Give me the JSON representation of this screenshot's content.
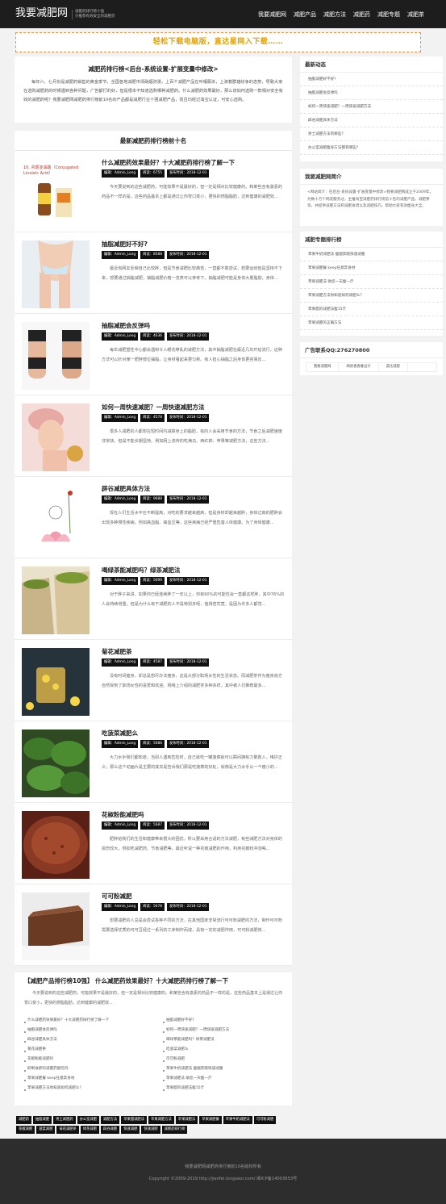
{
  "header": {
    "logo": "我要减肥网",
    "slogan_line1": "减肥药排行榜十强",
    "slogan_line2": "只推荐有效安全的减肥药",
    "nav": [
      "我要减肥网",
      "减肥产品",
      "减肥方法",
      "减肥药",
      "减肥专题",
      "减肥茶"
    ]
  },
  "banner": {
    "text": "轻松下载电脑版，直达星网入下载……"
  },
  "intro": {
    "title": "减肥药排行榜<后台-系统设置-扩展变量中修改>",
    "text": "每年六、七月份是减肥药销售的黄金季节，全国各地减肥市场硝烟弥漫，上百个减肥产品在叫嚷厮杀，上演着群雄纷争的态势，导致大家在选购减肥药的时候遇到各种问题，广告都打的好，但是根本不知道选购哪种减肥药。什么减肥药效果最好，那么该如何选购一款相对安全有效的减肥药呢？我要减肥网减肥药排行榜前10名的产品都是减肥行业十强减肥产品，而且均经过淘宝认证，可安心选购。"
  },
  "list_title": "最新减肥药排行榜前十名",
  "items": [
    {
      "title": "什么减肥药效果最好？十大减肥药排行榜了解一下",
      "author": "编辑：Admin_Long",
      "views": "阅读：6755",
      "date": "发布时间：2018-12-01",
      "desc": "今天要说到的这些减肥药，可能效果不是最好的，但一定是相对比较健康的。和某些含有激素的药品不一样的是，这些药品基本上都是通过让你胃口变小，更快的燃脂脂肪，达到健康的减肥效..."
    },
    {
      "title": "抽脂减肥好不好?",
      "author": "编辑：Admin_Long",
      "views": "阅读：8588",
      "date": "发布时间：2018-12-01",
      "desc": "最近有网友反映自己比较胖，但是节食减肥比较痛苦，一直都不敢尝试，想要运动但是坚持不下来，想要通过抽脂减肥，抽脂减肥价格一览表可以参考下。抽脂减肥可能是身体大量脂肪，身体..."
    },
    {
      "title": "抽脂减肥会反弹吗",
      "author": "编辑：Admin_Long",
      "views": "阅读：4636",
      "date": "发布时间：2018-12-01",
      "desc": "每年减肥塑性中心都会遇到令人眼花缭乱的减肥方法，其中抽脂减肥在最近几年开始流行，这种方法可以针对某一肥胖部位抽脂，让身材看起来更匀称。有人担心抽脂之后身体更容易反..."
    },
    {
      "title": "如何一周快速减肥？一周快速减肥方法",
      "author": "编辑：Admin_Long",
      "views": "阅读：4578",
      "date": "发布时间：2018-12-01",
      "desc": "很多人减肥的人都想在短时间内减掉身上的脂肪，有的人会采用节食的方法，节食之后减肥速度非常快，但是不能长期坚持。例如网上流传的吃满瓜、西红柿、苹果等减肥方法，这些方法..."
    },
    {
      "title": "辟谷减肥具体方法",
      "author": "编辑：Admin_Long",
      "views": "阅读：9688",
      "date": "发布时间：2018-12-01",
      "desc": "现在人们生活水平在不断提高，对吃的要求越来越高，但是身材却越来越胖，身体过高的肥胖会出现多种慢性疾病，例如高血脂、高血压等，这些疾病已经严重危害人体健康。为了身体健康..."
    },
    {
      "title": "喝绿茶能减肥吗？绿茶减肥法",
      "author": "编辑：Admin_Long",
      "views": "阅读：5699",
      "date": "发布时间：2018-12-01",
      "desc": "对于胖子来讲，如果你已经连续胖了一年以上，你有90%的可能性会一直都这样胖，其中76%的人会持续增重。但是为什么有于减肥的人不是特别多呢，值得查究竟，是因为许多人都觉..."
    },
    {
      "title": "菊花减肥茶",
      "author": "编辑：Admin_Long",
      "views": "阅读：4587",
      "date": "发布时间：2018-12-01",
      "desc": "没有时间健身，却总是想尽办法瘦身，这是大部分职场女性的生活状态。而减肥茶作为瘦身良方自然受到了职场女性的喜爱和欢迎。网络上介绍的减肥茶多种多样，其中被人们推荐最多..."
    },
    {
      "title": "吃菠菜减肥么",
      "author": "编辑：Admin_Long",
      "views": "阅读：5686",
      "date": "发布时间：2018-12-01",
      "desc": "大力水手我们都知道，当别人遇到危险时，自己就吃一罐菠菜就可以瞬间拥有力量救人，维护正义，那么这个动画片是主要的其实是告诉我们那是吃菠菜的好处，就像是大力水手从一个瘦小的..."
    },
    {
      "title": "花椒粉能减肥吗",
      "author": "编辑：Admin_Long",
      "views": "阅读：5687",
      "date": "发布时间：2018-12-01",
      "desc": "肥胖给我们的生活和健康带来很大的困扰，所以要采用合适的方法减肥，有些减肥方法对身体的损伤较大，例如吃减肥药、节食减肥等。最近听说一种花椒减肥的作用，利用花椒粉冲泡喝..."
    },
    {
      "title": "可可粉减肥",
      "author": "编辑：Admin_Long",
      "views": "阅读：5678",
      "date": "发布时间：2018-12-01",
      "desc": "想要减肥的人总是会尝试各种不同的方法，在其他国家非常流行可可粉减肥的方法，制作可可粉需要选择优质的可可豆经过一系列的工序制作而成，具有一定的减肥作用，可可粉减肥效..."
    }
  ],
  "bottom": {
    "title": "【减肥产品排行榜10强】 什么减肥药效果最好？十大减肥药排行榜了解一下",
    "desc": "今天要说到的这些减肥药，可能效果不是最好的，但一定是相对比较健康的。和某些含有激素的药品不一样的是，这些药品基本上是通过让你胃口变小，更快的燃脂脂肪，达到健康的减肥效...",
    "links": [
      "什么减肥药效果最好？十大减肥药排行榜了解一下",
      "抽脂减肥好不好?",
      "抽脂减肥会反弹吗",
      "如何一周快速减肥？一周快速减肥方法",
      "辟谷减肥具体方法",
      "喝绿茶能减肥吗？绿茶减肥法",
      "菊花减肥茶",
      "吃菠菜减肥么",
      "花椒粉能减肥吗",
      "可可粉减肥",
      "抑制食欲的减肥药能吃吗",
      "苹果牛奶减肥法 瘦腿奔跑快速减腰",
      "苹果减肥餐 keep任意奔身材",
      "苹果减肥法 助您一天瘦一斤",
      "苹果减肥方法你知道如何减肥么？",
      "苹果醋的减肥法瘦15斤"
    ]
  },
  "tags": [
    "减肥药",
    "抽脂减肥",
    "男士减肥药",
    "办公室减肥",
    "减肥方法",
    "苹果醋减肥法",
    "苹果减肥方法",
    "苹果减肥法",
    "苹果减肥餐",
    "苹果牛奶减肥法",
    "可可粉减肥",
    "花椒减肥",
    "菠菜减肥",
    "菊花减肥茶",
    "绿茶减肥",
    "辟谷减肥",
    "快速减肥",
    "快速减肥",
    "减肥药排行榜"
  ],
  "sidebar": {
    "news_title": "最新动态",
    "news": [
      "抽脂减肥好不好?",
      "抽脂减肥会反弹吗",
      "如何一周快速减肥？一周快速减肥方法",
      "辟谷减肥具体方法",
      "男士减肥方法有哪些？",
      "办公室减肥瘦身方法都有哪些？"
    ],
    "about_title": "我要减肥网简介",
    "about_text": "<网站简介：在后台-系统设置-扩展变量中修改>我要减肥网成立于2009年，为数十万个网友服务过，主推淘宝减肥药排行榜前十名的减肥产品，减肥茶等，并提供减肥方法和减肥食谱以及减肥技巧，帮助大家有效瘦身大全。",
    "topic_title": "减肥专题排行榜",
    "topics": [
      "苹果牛奶减肥法 瘦腿奔跑快速减腰",
      "苹果减肥餐 keep任意奔身材",
      "苹果减肥法 助您一天瘦一斤",
      "苹果减肥方法你知道如何减肥么？",
      "苹果醋的减肥法瘦15斤",
      "苹果减肥的正确方法"
    ],
    "ad_title": "广告联系QQ:276270800",
    "ad_cells": [
      "我要减肥网",
      "网易香香雅设计",
      "菜比减肥"
    ]
  },
  "footer": {
    "line1": "我要减肥网减肥药排行榜前10名版权所有",
    "line2": "Copyright ©2009-2019 http://jianfei.longseor.com/ 闽ICP备14003653号"
  }
}
